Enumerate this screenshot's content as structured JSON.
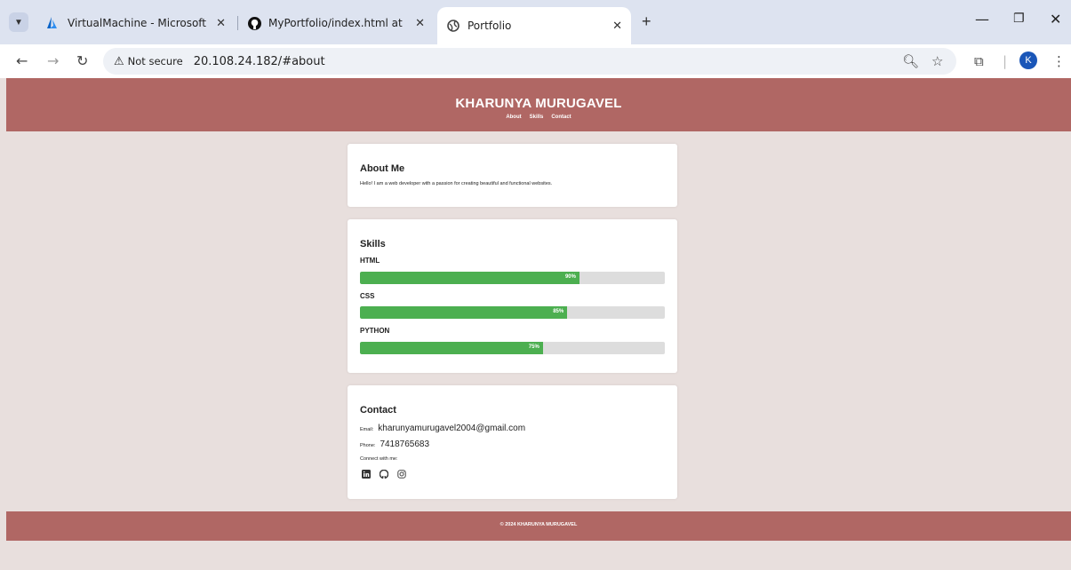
{
  "browser": {
    "tabs": [
      {
        "title": "VirtualMachine - Microsoft Azure",
        "icon": "azure-icon"
      },
      {
        "title": "MyPortfolio/index.html at main · K",
        "icon": "github-icon"
      },
      {
        "title": "Portfolio",
        "icon": "globe-icon"
      }
    ],
    "tab_close_glyph": "✕",
    "new_tab_glyph": "+",
    "not_secure_label": "Not secure",
    "url": "20.108.24.182/#about",
    "profile_initial": "K"
  },
  "site": {
    "title": "KHARUNYA MURUGAVEL",
    "nav": [
      "About",
      "Skills",
      "Contact"
    ],
    "footer": "© 2024 KHARUNYA MURUGAVEL",
    "header_color": "#b06764",
    "background_color": "#e8dfdd"
  },
  "about": {
    "heading": "About Me",
    "text": "Hello! I am a web developer with a passion for creating beautiful and functional websites."
  },
  "skills": {
    "heading": "Skills",
    "bar_color": "#4caf50",
    "items": [
      {
        "name": "HTML",
        "percent": 90,
        "label": "90%"
      },
      {
        "name": "CSS",
        "percent": 85,
        "label": "85%"
      },
      {
        "name": "PYTHON",
        "percent": 75,
        "label": "75%"
      }
    ]
  },
  "contact": {
    "heading": "Contact",
    "email_label": "Email:",
    "email": "kharunyamurugavel2004@gmail.com",
    "phone_label": "Phone:",
    "phone": "7418765683",
    "connect_label": "Connect with me:",
    "social_icons": [
      "linkedin-icon",
      "github-icon",
      "instagram-icon"
    ]
  }
}
